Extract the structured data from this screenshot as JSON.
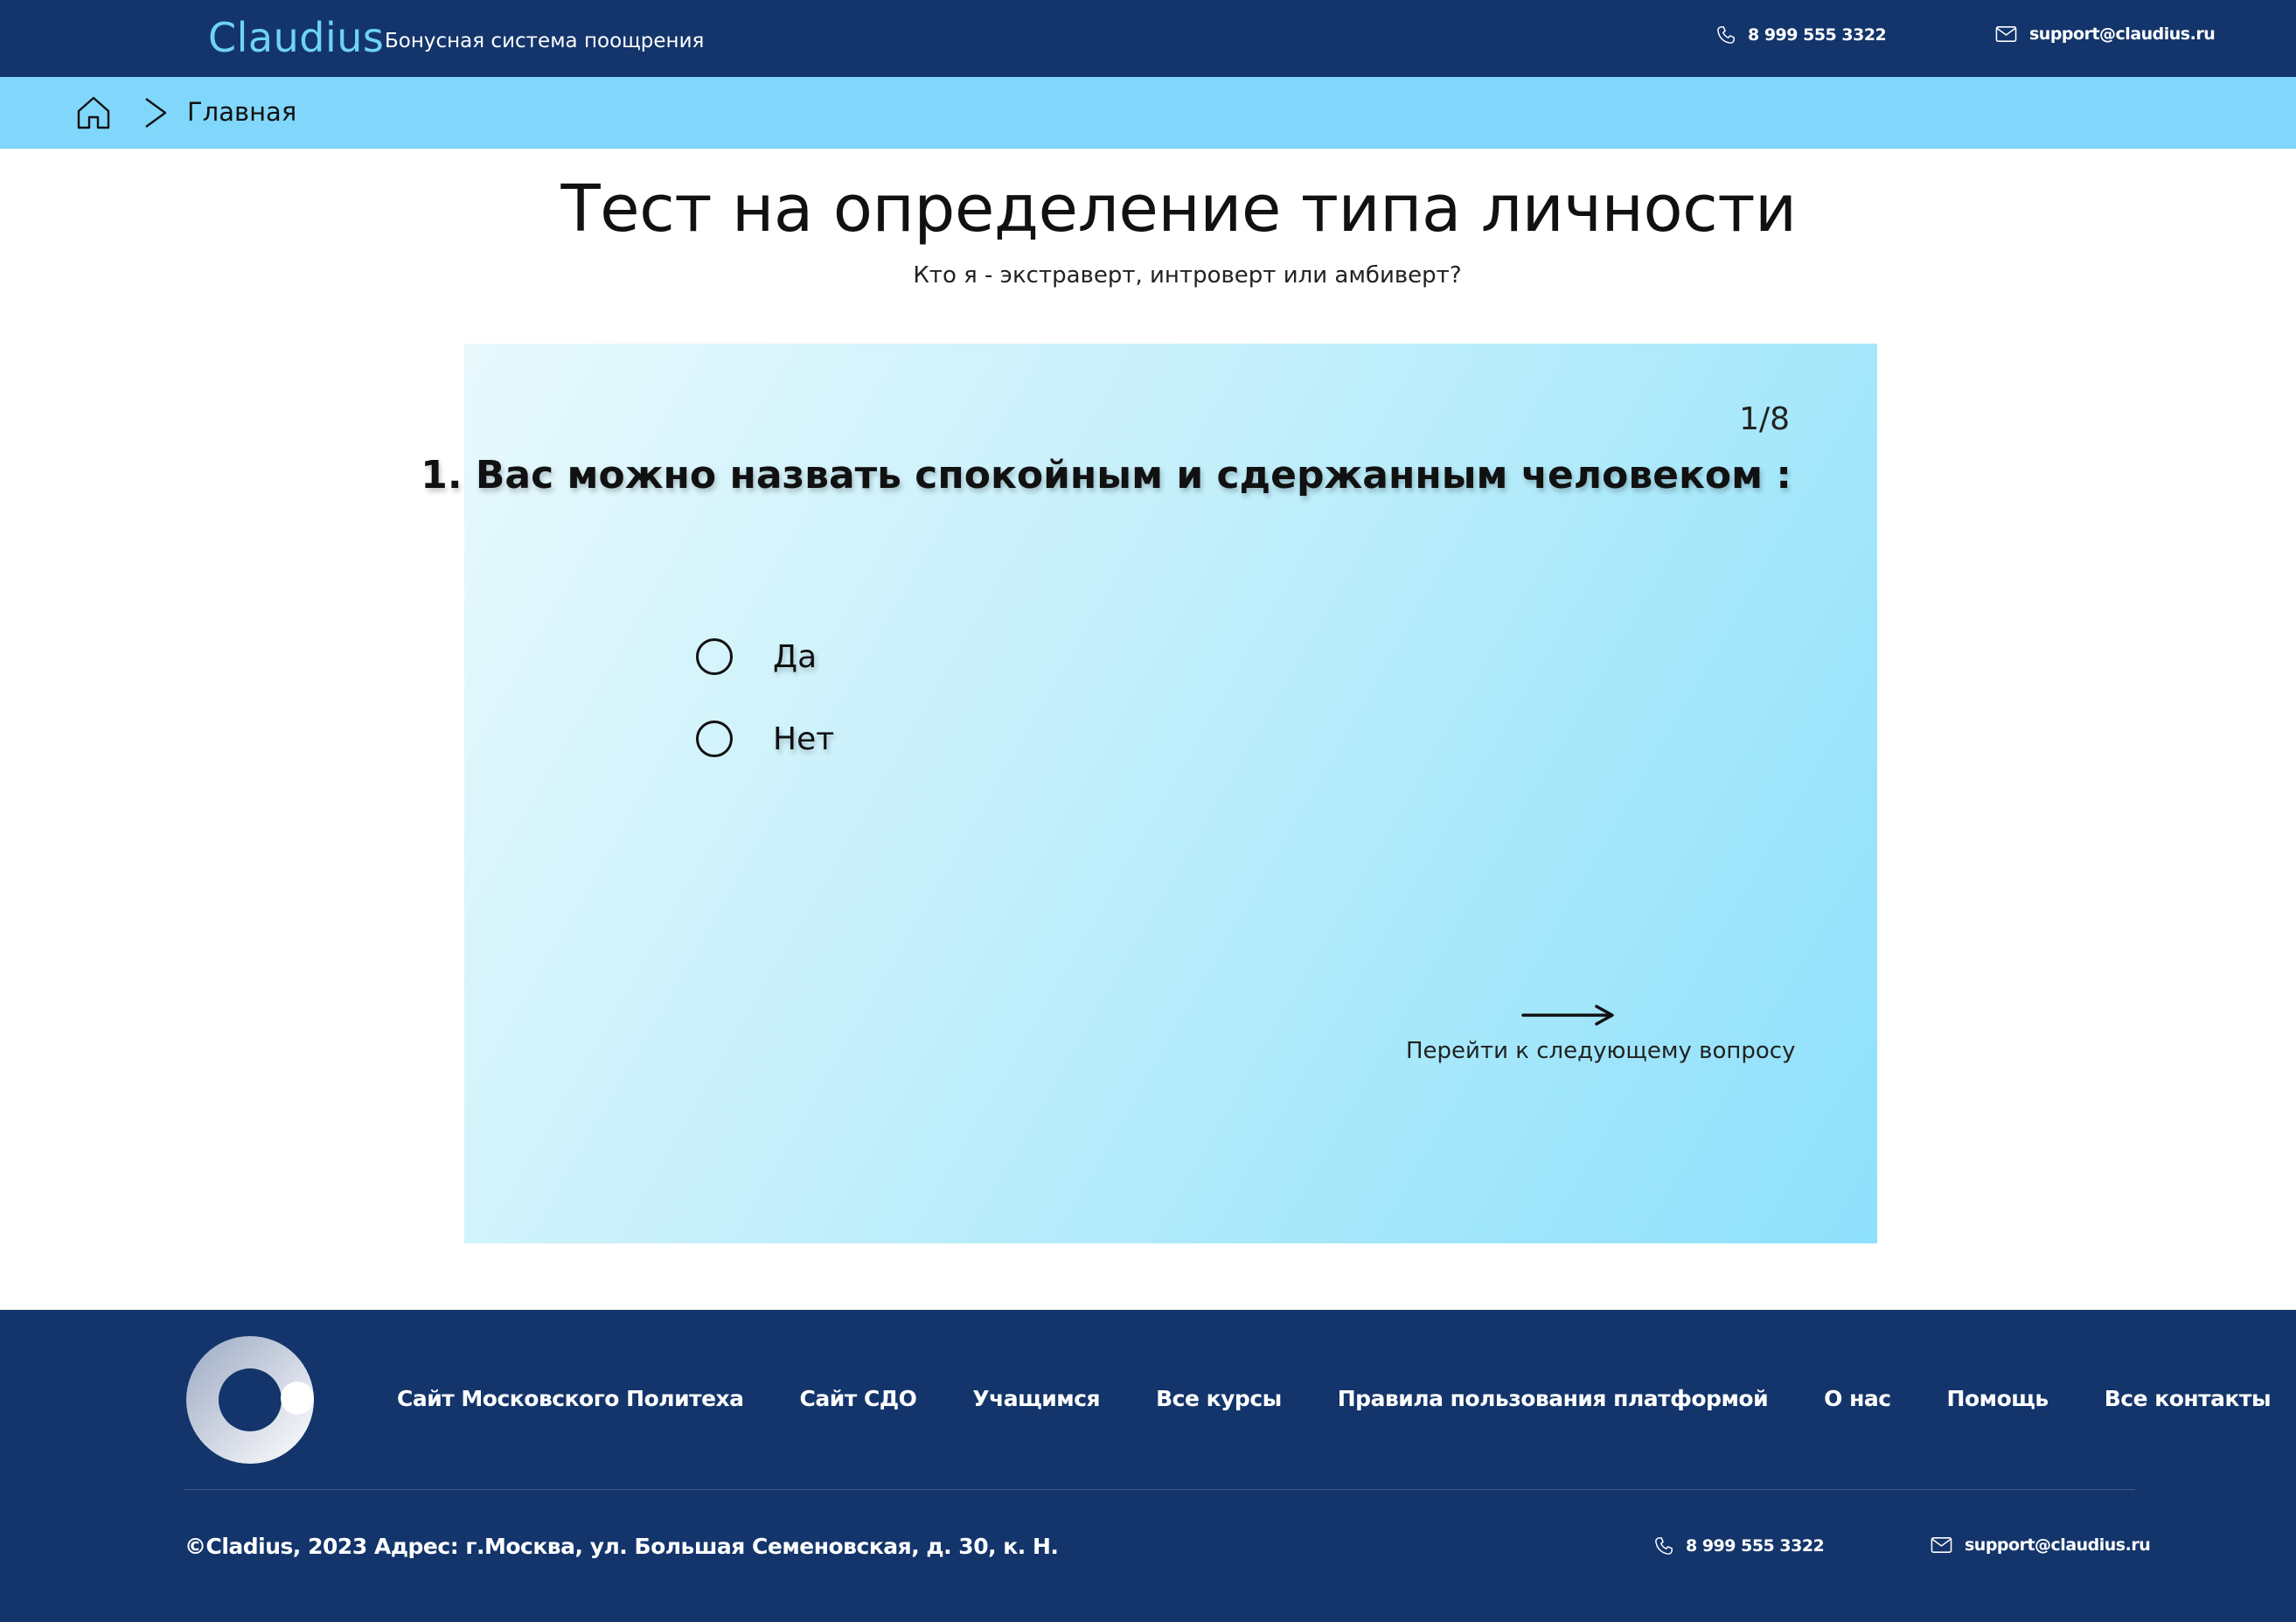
{
  "header": {
    "brand": "Claudius",
    "tagline": "Бонусная система поощрения",
    "phone": "8 999 555 3322",
    "email": "support@claudius.ru",
    "phone_icon": "phone-icon",
    "email_icon": "mail-icon"
  },
  "breadcrumb": {
    "home_icon": "home-icon",
    "separator_icon": "chevron-right-icon",
    "current": "Главная"
  },
  "page": {
    "title": "Тест на определение типа личности",
    "subtitle": "Кто я - экстраверт, интроверт или амбиверт?"
  },
  "quiz": {
    "counter": "1/8",
    "question": "1. Вас можно назвать спокойным и сдержанным человеком :",
    "options": [
      {
        "label": "Да",
        "selected": false
      },
      {
        "label": "Нет",
        "selected": false
      }
    ],
    "next_label": "Перейти к следующему вопросу",
    "next_icon": "arrow-right-icon"
  },
  "footer": {
    "nav": [
      "Сайт Московского Политеха",
      "Сайт СДО",
      "Учащимся",
      "Все курсы",
      "Правила пользования платформой",
      "О нас",
      "Помощь",
      "Все контакты"
    ],
    "copyright": "©Cladius, 2023",
    "address": "Адрес: г.Москва, ул. Большая Семеновская, д. 30, к. Н.",
    "phone": "8 999 555 3322",
    "email": "support@claudius.ru"
  },
  "colors": {
    "header_bg": "#13356b",
    "brand": "#6fd3f5",
    "breadcrumb_bg": "#80d7fb",
    "card_start": "#e8f9fd",
    "card_end": "#8ee0fb",
    "footer_bg": "#13356b"
  }
}
